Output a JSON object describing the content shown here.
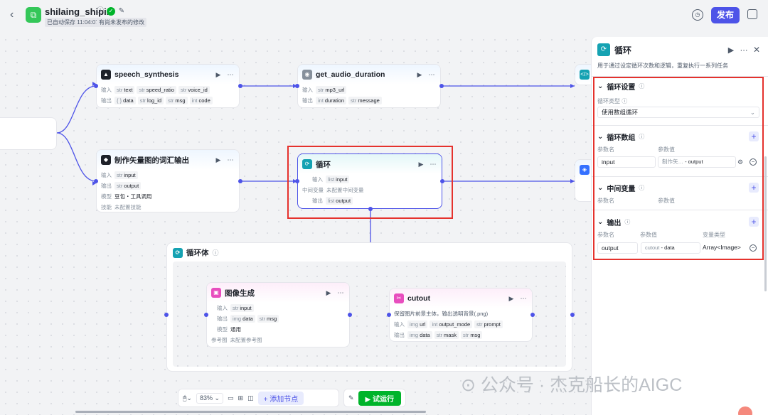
{
  "header": {
    "title": "shilaing_shipin",
    "autosave": "已自动保存 11:04:07",
    "unpublished": "有尚未发布的修改",
    "publish_label": "发布"
  },
  "nodes": {
    "speech": {
      "title": "speech_synthesis",
      "in_label": "输入",
      "out_label": "输出",
      "inputs": [
        [
          "str",
          "text"
        ],
        [
          "str",
          "speed_ratio"
        ],
        [
          "str",
          "voice_id"
        ]
      ],
      "outputs": [
        [
          "{ }",
          "data"
        ],
        [
          "str",
          "log_id"
        ],
        [
          "str",
          "msg"
        ],
        [
          "int",
          "code"
        ]
      ]
    },
    "audio": {
      "title": "get_audio_duration",
      "in_label": "输入",
      "out_label": "输出",
      "inputs": [
        [
          "str",
          "mp3_url"
        ]
      ],
      "outputs": [
        [
          "int",
          "duration"
        ],
        [
          "str",
          "message"
        ]
      ]
    },
    "vector": {
      "title": "制作矢量图的词汇输出",
      "in_label": "输入",
      "out_label": "输出",
      "model_label": "模型",
      "skill_label": "技能",
      "input": "input",
      "output": "output",
      "model": "豆包・工具调用",
      "skill": "未配置技能"
    },
    "loop": {
      "title": "循环",
      "in_label": "输入",
      "var_label": "中间变量",
      "out_label": "输出",
      "input": "input",
      "var_value": "未配置中间变量",
      "output": "output"
    },
    "image_gen": {
      "title": "图像生成",
      "in_label": "输入",
      "out_label": "输出",
      "model_label": "模型",
      "ref_label": "参考图",
      "input": "input",
      "outputs": [
        [
          "img",
          "data"
        ],
        [
          "str",
          "msg"
        ]
      ],
      "model": "通用",
      "ref": "未配置参考图"
    },
    "cutout": {
      "title": "cutout",
      "desc": "保留图片前景主体，输出透明背景(.png)",
      "in_label": "输入",
      "out_label": "输出",
      "inputs": [
        [
          "img",
          "url"
        ],
        [
          "int",
          "output_mode"
        ],
        [
          "str",
          "prompt"
        ]
      ],
      "outputs": [
        [
          "img",
          "data"
        ],
        [
          "str",
          "mask"
        ],
        [
          "str",
          "msg"
        ]
      ]
    }
  },
  "loop_body": {
    "title": "循环体"
  },
  "panel": {
    "title": "循环",
    "desc": "用于通过设定循环次数和逻辑，重复执行一系列任务",
    "loop_settings": "循环设置",
    "loop_type_label": "循环类型",
    "loop_type_value": "使用数组循环",
    "loop_array": "循环数组",
    "param_name": "参数名",
    "param_value": "参数值",
    "array_name": "input",
    "array_src": "制作矢…",
    "array_src_var": "output",
    "middle_var": "中间变量",
    "output_section": "输出",
    "var_type": "变量类型",
    "output_name": "output",
    "output_src": "cutout",
    "output_src_var": "data",
    "output_type": "Array<Image>"
  },
  "toolbar": {
    "zoom": "83%",
    "add_node": "添加节点",
    "run": "试运行"
  },
  "watermark": "公众号 · 杰克船长的AIGC",
  "colors": {
    "accent": "#4d53e8",
    "run": "#00b42a",
    "highlight": "#e5322d",
    "loop": "#15a2b2"
  }
}
